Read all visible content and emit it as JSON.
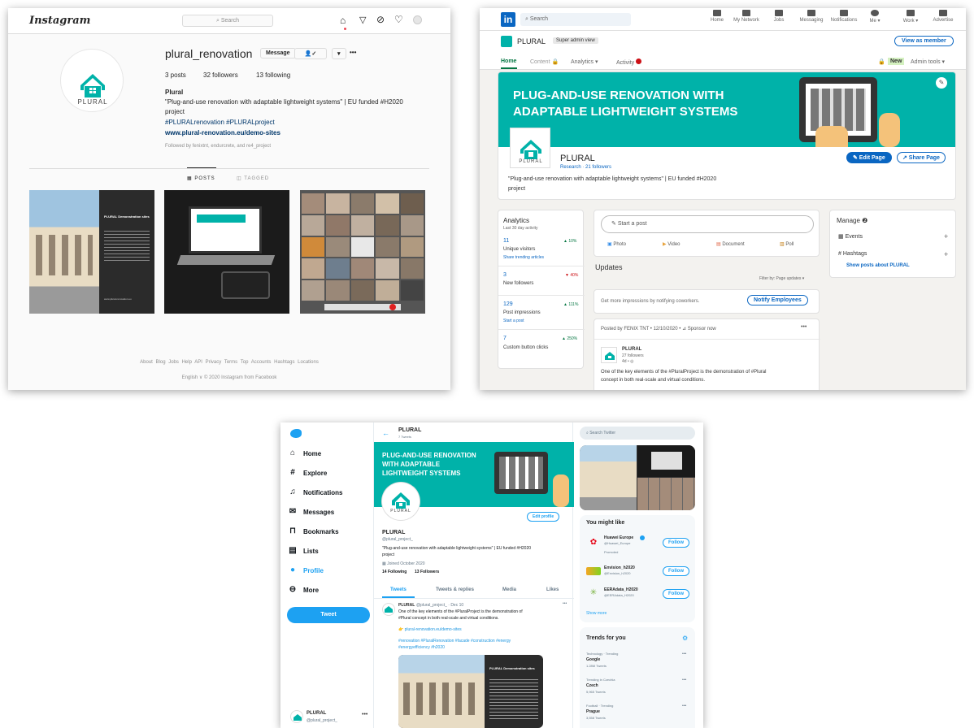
{
  "instagram": {
    "brand": "Instagram",
    "search_placeholder": "Search",
    "username": "plural_renovation",
    "message_btn": "Message",
    "more_btn": "•••",
    "stats": {
      "posts": "3 posts",
      "followers": "32 followers",
      "following": "13 following"
    },
    "name": "Plural",
    "bio_line1": "\"Plug-and-use renovation with adaptable lightweight systems\" | EU funded #H2020",
    "bio_line2": "project",
    "hashtags": "#PLURALrenovation #PLURALproject",
    "website": "www.plural-renovation.eu/demo-sites",
    "followed_by": "Followed by fenixtnt, endurcrete, and re4_project",
    "tabs": {
      "posts": "POSTS",
      "tagged": "TAGGED"
    },
    "post1_title": "PLURAL Demonstration sites",
    "post1_url": "www.plural-renovation.eu",
    "footer_links": [
      "About",
      "Blog",
      "Jobs",
      "Help",
      "API",
      "Privacy",
      "Terms",
      "Top Accounts",
      "Hashtags",
      "Locations"
    ],
    "footer_copy": "English ∨   © 2020 Instagram from Facebook",
    "logo_text": "PLURAL"
  },
  "linkedin": {
    "logo": "in",
    "search_placeholder": "Search",
    "nav": [
      "Home",
      "My Network",
      "Jobs",
      "Messaging",
      "Notifications",
      "Me ▾",
      "Work ▾",
      "Advertise"
    ],
    "company": "PLURAL",
    "badge": "Super admin view",
    "view_member": "View as member",
    "tabs": {
      "home": "Home",
      "content": "Content",
      "analytics": "Analytics ▾",
      "activity": "Activity"
    },
    "new_badge": "New",
    "admin_tools": "Admin tools ▾",
    "banner_line1": "PLUG-AND-USE RENOVATION WITH",
    "banner_line2": "ADAPTABLE LIGHTWEIGHT SYSTEMS",
    "logo_text": "PLURAL",
    "page_name": "PLURAL",
    "page_sub": "Research · 21 followers",
    "edit_page": "✎ Edit Page",
    "share_page": "↗ Share Page",
    "tagline1": "\"Plug-and-use renovation with adaptable lightweight systems\" | EU funded #H2020",
    "tagline2": "project",
    "analytics": {
      "title": "Analytics",
      "sub": "Last 30 day activity",
      "items": [
        {
          "value": "11",
          "delta": "▲ 10%",
          "label": "Unique visitors",
          "link": "Share trending articles"
        },
        {
          "value": "3",
          "delta": "▼ 40%",
          "label": "New followers",
          "link": ""
        },
        {
          "value": "129",
          "delta": "▲ 111%",
          "label": "Post impressions",
          "link": "Start a post"
        },
        {
          "value": "7",
          "delta": "▲ 250%",
          "label": "Custom button clicks",
          "link": ""
        }
      ]
    },
    "start_post": "Start a post",
    "post_actions": [
      "Photo",
      "Video",
      "Document",
      "Poll"
    ],
    "updates": "Updates",
    "filter": "Filter by: Page updates ▾",
    "notify_text": "Get more impressions by notifying coworkers.",
    "notify_btn": "Notify Employees",
    "posted_by": "Posted by FENIX TNT  •  12/10/2020  •  ⊿ Sponsor now",
    "post_dots": "•••",
    "post_company": "PLURAL",
    "post_followers": "27 followers",
    "post_age": "4d • ◎",
    "post_text1": "One of the key elements of the #PluralProject is the demonstration of #Plural",
    "post_text2": "concept in both real-scale and virtual conditions.",
    "manage": {
      "title": "Manage ❷",
      "events": "Events",
      "hashtags": "# Hashtags",
      "show_posts": "Show posts about PLURAL",
      "plus": "+"
    }
  },
  "twitter": {
    "nav": [
      "Home",
      "Explore",
      "Notifications",
      "Messages",
      "Bookmarks",
      "Lists",
      "Profile",
      "More"
    ],
    "tweet_btn": "Tweet",
    "account_name": "PLURAL",
    "account_handle": "@plural_project_",
    "header_name": "PLURAL",
    "header_tweets": "7 Tweets",
    "search_placeholder": "Search Twitter",
    "banner_line1": "PLUG-AND-USE RENOVATION",
    "banner_line2": "WITH ADAPTABLE",
    "banner_line3": "LIGHTWEIGHT SYSTEMS",
    "logo_text": "PLURAL",
    "edit_profile": "Edit profile",
    "profile_name": "PLURAL",
    "profile_handle": "@plural_project_",
    "bio1": "\"Plug-and-use renovation with adaptable lightweight systems\" | EU funded #H2020",
    "bio2": "project",
    "joined": "Joined October 2020",
    "following": "14 Following",
    "followers": "13 Followers",
    "tabs": [
      "Tweets",
      "Tweets & replies",
      "Media",
      "Likes"
    ],
    "tweet_author": "PLURAL",
    "tweet_meta": "@plural_project_ · Dec 10",
    "tweet_text1": "One of the key elements of the #PluralProject is the demonstration of",
    "tweet_text2": "#Plural concept in both real-scale and virtual conditions.",
    "tweet_link": "👉 plural-renovation.eu/demo-sites",
    "tweet_tags1": "#renovation #PluralRenovation #facade #construction #energy",
    "tweet_tags2": "#energyefficiency #h2020",
    "tweet_img_title": "PLURAL Demonstration sites",
    "you_might_like": "You might like",
    "suggestions": [
      {
        "name": "Huawei Europe",
        "handle": "@Huawei_Europe",
        "extra": "Promoted",
        "btn": "Follow"
      },
      {
        "name": "Envision_h2020",
        "handle": "@Envision_h2020",
        "extra": "",
        "btn": "Follow"
      },
      {
        "name": "EERAdata_H2020",
        "handle": "@EERAdata_H2020",
        "extra": "",
        "btn": "Follow"
      }
    ],
    "show_more": "Show more",
    "trends_title": "Trends for you",
    "trends": [
      {
        "context": "Technology · Trending",
        "name": "Google",
        "count": "1.28M Tweets"
      },
      {
        "context": "Trending in Czechia",
        "name": "Czech",
        "count": "5,965 Tweets"
      },
      {
        "context": "Football · Trending",
        "name": "Prague",
        "count": "3,558 Tweets"
      }
    ]
  }
}
